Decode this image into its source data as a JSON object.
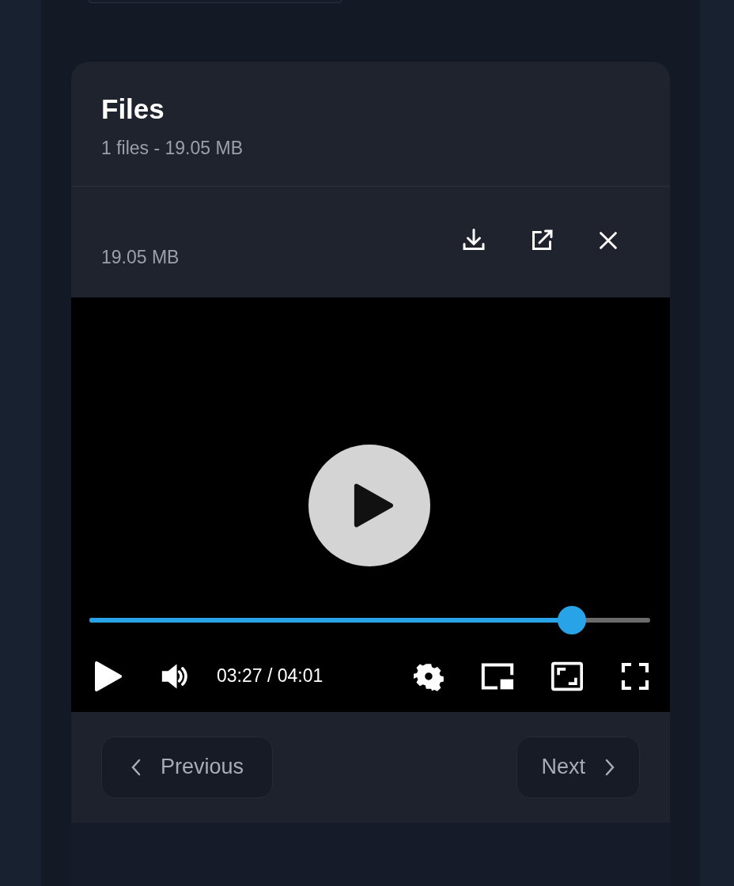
{
  "files_panel": {
    "title": "Files",
    "summary": "1 files - 19.05 MB"
  },
  "file": {
    "size": "19.05 MB"
  },
  "player": {
    "paused": true,
    "level": 0.86,
    "time": "03:27 / 04:01"
  },
  "navigation": {
    "previous": "Previous",
    "next": "Next"
  }
}
